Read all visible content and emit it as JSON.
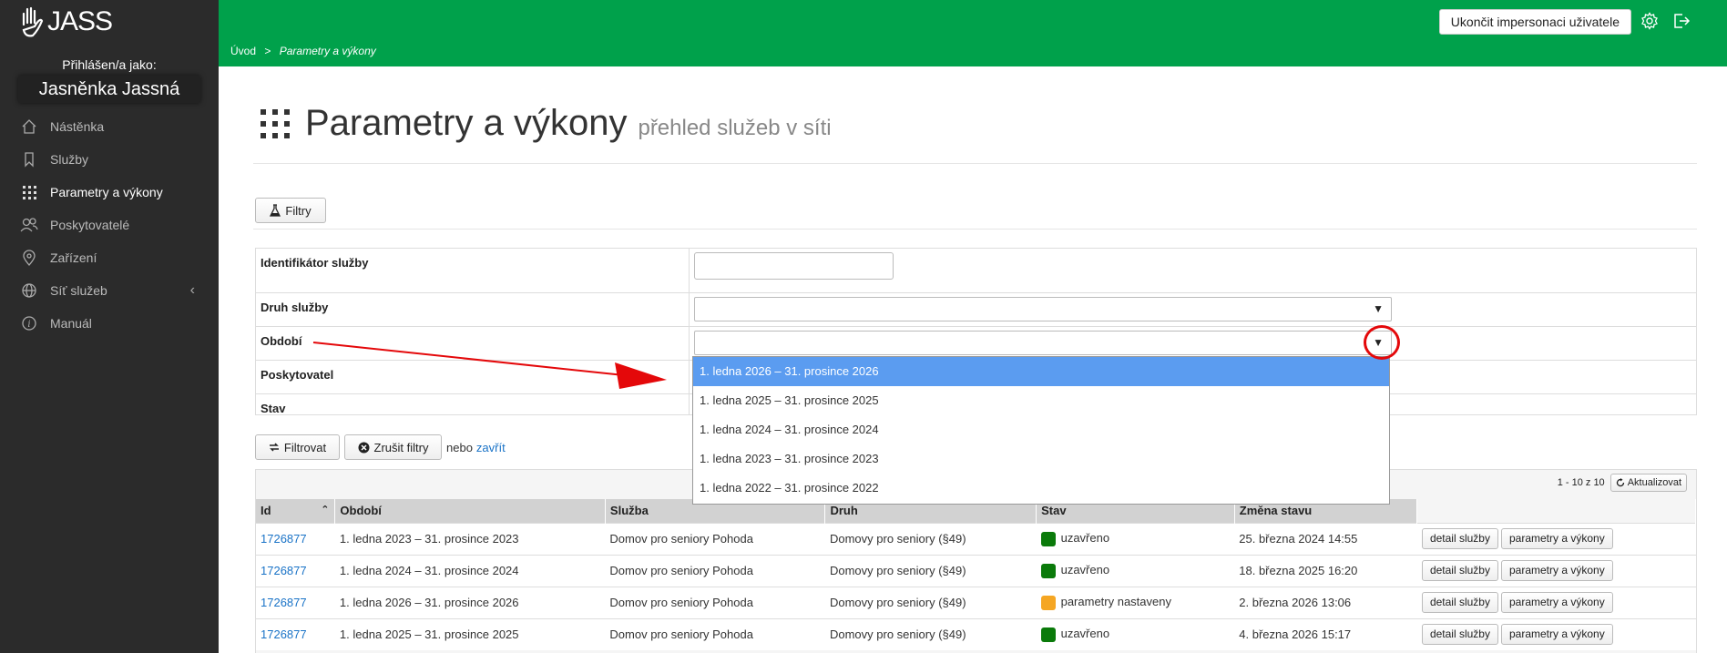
{
  "app": {
    "logo_text": "JASS"
  },
  "sidebar": {
    "logged_as_label": "Přihlášen/a jako:",
    "user_name": "Jasněnka Jassná",
    "items": [
      {
        "label": "Nástěnka",
        "icon": "home-icon"
      },
      {
        "label": "Služby",
        "icon": "bookmark-icon"
      },
      {
        "label": "Parametry a výkony",
        "icon": "grid-icon",
        "active": true
      },
      {
        "label": "Poskytovatelé",
        "icon": "users-icon"
      },
      {
        "label": "Zařízení",
        "icon": "map-pin-icon"
      },
      {
        "label": "Síť služeb",
        "icon": "globe-icon"
      },
      {
        "label": "Manuál",
        "icon": "info-icon"
      }
    ]
  },
  "header": {
    "stop_impersonation_label": "Ukončit impersonaci uživatele",
    "breadcrumb": {
      "home": "Úvod",
      "separator": ">",
      "current": "Parametry a výkony"
    }
  },
  "page": {
    "title": "Parametry a výkony",
    "subtitle": "přehled služeb v síti",
    "filters_button": "Filtry"
  },
  "filter_form": {
    "rows": [
      {
        "label": "Identifikátor služby"
      },
      {
        "label": "Druh služby"
      },
      {
        "label": "Období"
      },
      {
        "label": "Poskytovatel"
      },
      {
        "label": "Stav"
      }
    ],
    "period_options": [
      "1. ledna 2026 – 31. prosince 2026",
      "1. ledna 2025 – 31. prosince 2025",
      "1. ledna 2024 – 31. prosince 2024",
      "1. ledna 2023 – 31. prosince 2023",
      "1. ledna 2022 – 31. prosince 2022"
    ],
    "selected_option_index": 0,
    "filter_button": "Filtrovat",
    "clear_button": "Zrušit filtry",
    "or_text": "nebo",
    "close_link": "zavřít"
  },
  "table": {
    "pagination": "1 - 10 z 10",
    "refresh_button": "Aktualizovat",
    "columns": [
      "Id",
      "Období",
      "Služba",
      "Druh",
      "Stav",
      "Změna stavu",
      ""
    ],
    "rows": [
      {
        "id": "1726877",
        "period": "1. ledna 2023 – 31. prosince 2023",
        "service": "Domov pro seniory Pohoda",
        "type": "Domovy pro seniory (§49)",
        "status": "uzavřeno",
        "status_color": "#0a7a0a",
        "changed": "25. března 2024 14:55"
      },
      {
        "id": "1726877",
        "period": "1. ledna 2024 – 31. prosince 2024",
        "service": "Domov pro seniory Pohoda",
        "type": "Domovy pro seniory (§49)",
        "status": "uzavřeno",
        "status_color": "#0a7a0a",
        "changed": "18. března 2025 16:20"
      },
      {
        "id": "1726877",
        "period": "1. ledna 2026 – 31. prosince 2026",
        "service": "Domov pro seniory Pohoda",
        "type": "Domovy pro seniory (§49)",
        "status": "parametry nastaveny",
        "status_color": "#f5a623",
        "changed": "2. března 2026 13:06"
      },
      {
        "id": "1726877",
        "period": "1. ledna 2025 – 31. prosince 2025",
        "service": "Domov pro seniory Pohoda",
        "type": "Domovy pro seniory (§49)",
        "status": "uzavřeno",
        "status_color": "#0a7a0a",
        "changed": "4. března 2026 15:17"
      }
    ],
    "detail_button": "detail služby",
    "params_button": "parametry a výkony"
  },
  "colors": {
    "topbar": "#00a14b",
    "sidebar": "#2b2b2b",
    "link": "#1a73c7",
    "selected_option": "#5b9cf0",
    "annotation": "#e4080a"
  }
}
